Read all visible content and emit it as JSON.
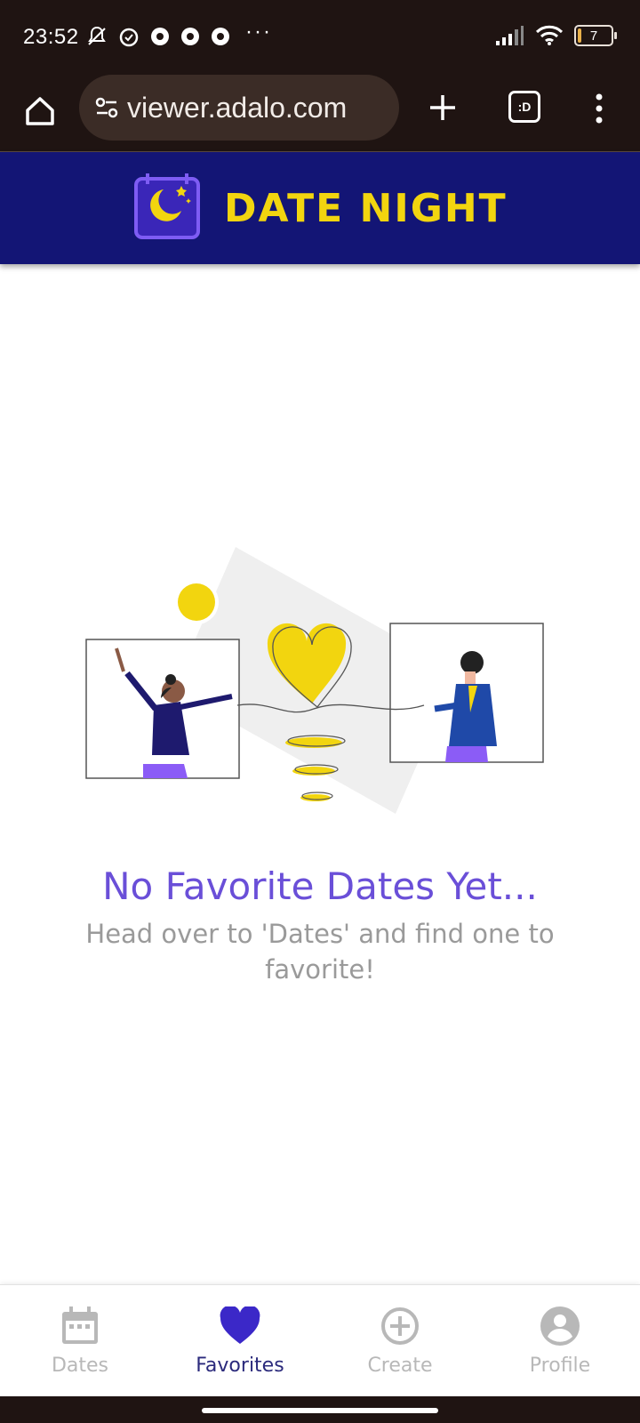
{
  "status_bar": {
    "time": "23:52",
    "dots": "···",
    "battery": "7"
  },
  "browser": {
    "url": "viewer.adalo.com",
    "tabs_label": ":D"
  },
  "app": {
    "title": "DATE NIGHT"
  },
  "empty_state": {
    "title": "No Favorite Dates Yet...",
    "subtitle": "Head over to 'Dates' and find one to favorite!"
  },
  "nav": {
    "items": [
      {
        "label": "Dates",
        "icon": "calendar-icon"
      },
      {
        "label": "Favorites",
        "icon": "heart-icon"
      },
      {
        "label": "Create",
        "icon": "add-circle-icon"
      },
      {
        "label": "Profile",
        "icon": "account-icon"
      }
    ],
    "active_color": "#3b28c8",
    "inactive_color": "#b8b8b8"
  },
  "colors": {
    "header_bg": "#131575",
    "brand_yellow": "#f2d50f",
    "title_purple": "#6a4fd8"
  }
}
